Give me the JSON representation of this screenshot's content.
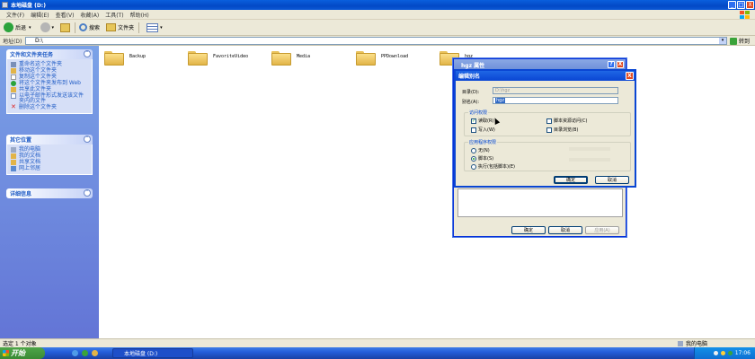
{
  "window": {
    "title": "本地磁盘 (D:)",
    "buttons": [
      "_",
      "□",
      "X"
    ]
  },
  "menubar": [
    "文件(F)",
    "编辑(E)",
    "查看(V)",
    "收藏(A)",
    "工具(T)",
    "帮助(H)"
  ],
  "toolbar": {
    "back_label": "后退",
    "search_label": "搜索",
    "folders_label": "文件夹"
  },
  "address": {
    "label": "地址(D)",
    "value": "D:\\",
    "go_label": "转到"
  },
  "left_panel": {
    "file_tasks": {
      "title": "文件和文件夹任务",
      "items": [
        "重命名这个文件夹",
        "移动这个文件夹",
        "复制这个文件夹",
        "将这个文件夹发布到 Web",
        "共享此文件夹",
        "以电子邮件形式发送该文件夹内的文件",
        "删除这个文件夹"
      ]
    },
    "other_places": {
      "title": "其它位置",
      "items": [
        "我的电脑",
        "我的文档",
        "共享文档",
        "网上邻居"
      ]
    },
    "details": {
      "title": "详细信息"
    }
  },
  "folders": [
    "Backup",
    "FavoriteVideo",
    "Media",
    "PPDownload",
    "hgz"
  ],
  "status": {
    "left": "选定 1 个对象",
    "right": "我的电脑"
  },
  "taskbar": {
    "start_label": "开始",
    "task_label": "本地磁盘 (D:)",
    "time": "17:06"
  },
  "properties_dialog": {
    "title": "hgz 属性",
    "title_buttons": [
      "?",
      "X"
    ],
    "ok_label": "确定",
    "cancel_label": "取消",
    "apply_label": "应用(A)"
  },
  "alias_dialog": {
    "title": "编辑别名",
    "directory_label": "目录(D):",
    "directory_value": "D:\\hgz",
    "alias_label": "别名(A):",
    "alias_value": "hgz",
    "access_group": {
      "title": "访问权限",
      "read": "读取(R)",
      "write": "写入(W)",
      "script_source": "脚本资源访问(C)",
      "dir_browse": "目录浏览(B)"
    },
    "app_group": {
      "title": "应用程序权限",
      "none": "无(N)",
      "scripts": "脚本(S)",
      "execute": "执行(包括脚本)(E)"
    },
    "ok_label": "确定",
    "cancel_label": "取消",
    "close_label": "X"
  }
}
